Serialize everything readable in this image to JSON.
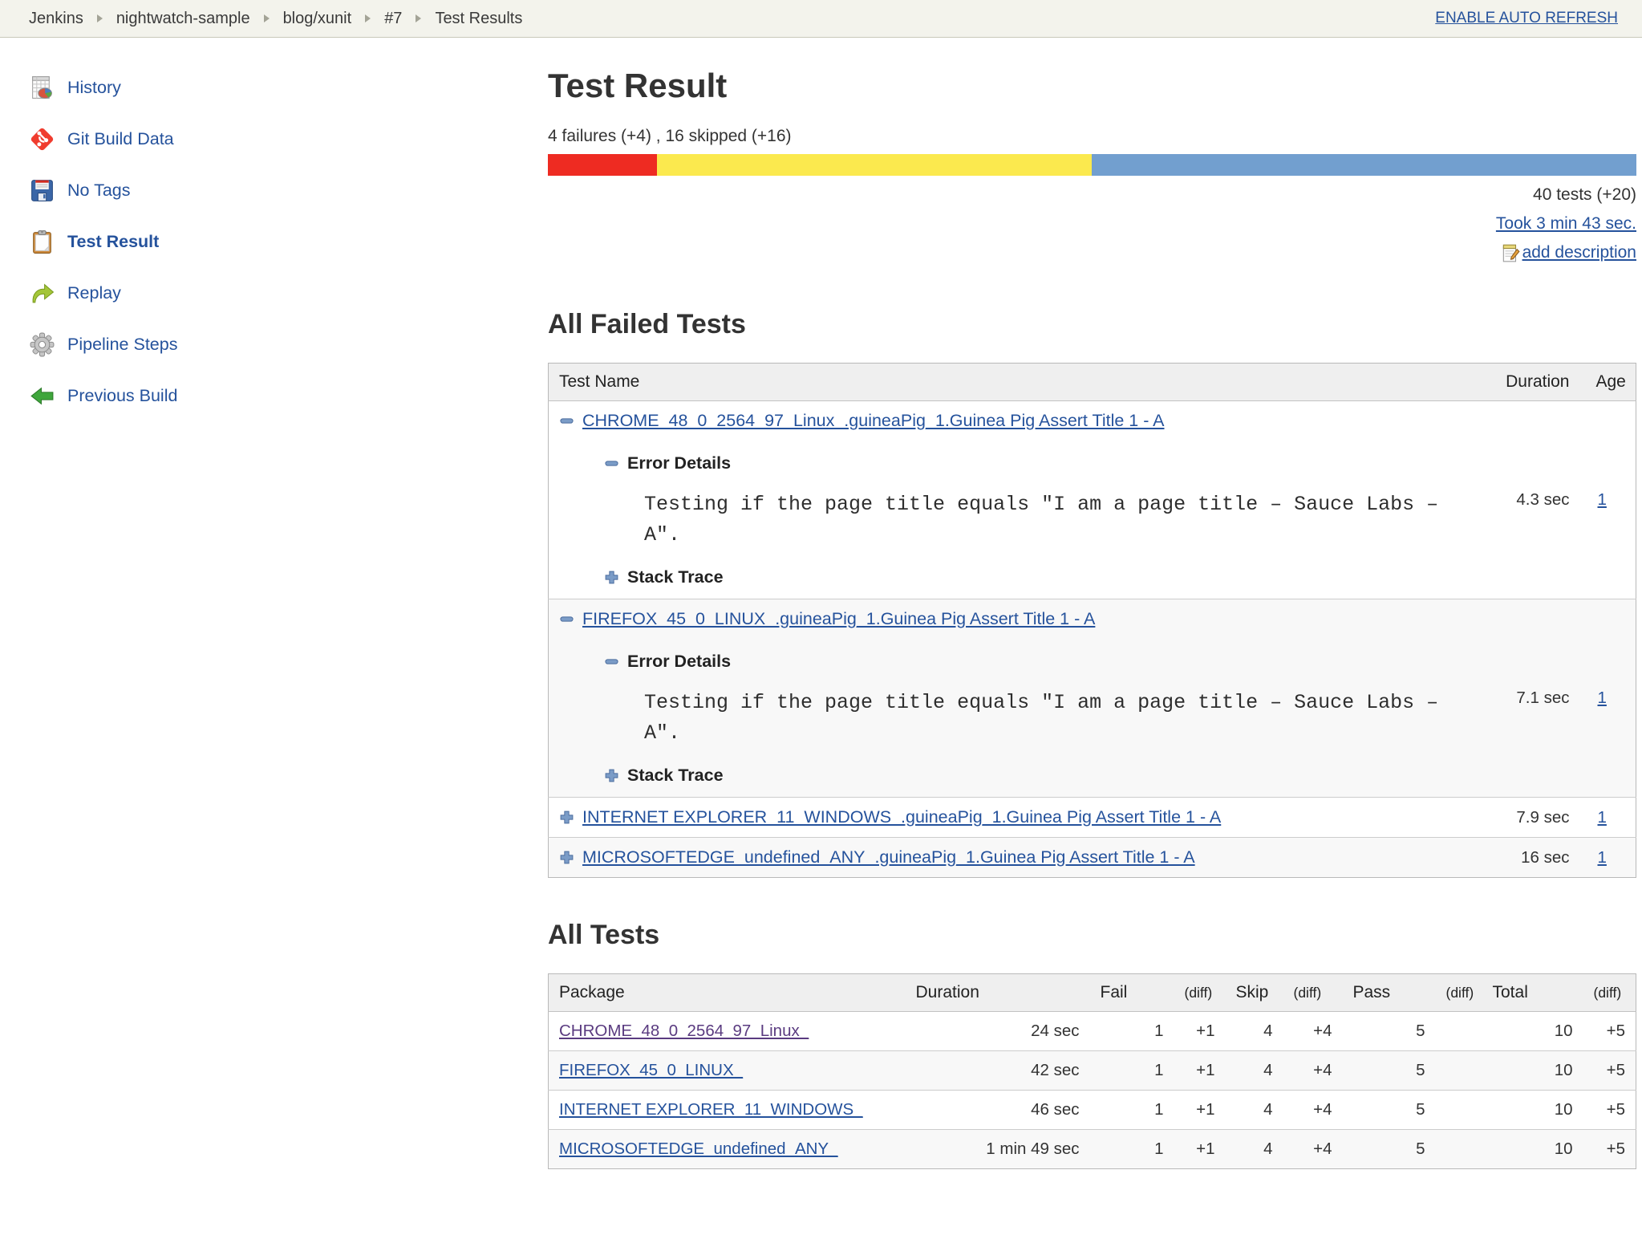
{
  "colors": {
    "link": "#25529c",
    "visited": "#5a3b80",
    "topbar_bg": "#f3f3ec",
    "bar_fail": "#ee2b22",
    "bar_skip": "#fbe94e",
    "bar_pass": "#729fcf"
  },
  "topbar": {
    "breadcrumb": [
      "Jenkins",
      "nightwatch-sample",
      "blog/xunit",
      "#7",
      "Test Results"
    ],
    "auto_refresh_label": "ENABLE AUTO REFRESH"
  },
  "sidebar": {
    "items": [
      {
        "label": "History",
        "icon": "history-icon",
        "active": false
      },
      {
        "label": "Git Build Data",
        "icon": "git-icon",
        "active": false
      },
      {
        "label": "No Tags",
        "icon": "floppy-disk-icon",
        "active": false
      },
      {
        "label": "Test Result",
        "icon": "clipboard-icon",
        "active": true
      },
      {
        "label": "Replay",
        "icon": "replay-arrow-icon",
        "active": false
      },
      {
        "label": "Pipeline Steps",
        "icon": "gear-icon",
        "active": false
      },
      {
        "label": "Previous Build",
        "icon": "previous-build-arrow-icon",
        "active": false
      }
    ]
  },
  "main": {
    "title": "Test Result",
    "summary": "4 failures (+4) , 16 skipped (+16)",
    "bar": {
      "fail_pct": 10,
      "skip_pct": 40,
      "pass_pct": 50
    },
    "tests_count": "40 tests (+20)",
    "took_label": "Took 3 min 43 sec.",
    "add_description_label": "add description",
    "failed": {
      "heading": "All Failed Tests",
      "col_test_name": "Test Name",
      "col_duration": "Duration",
      "col_age": "Age",
      "error_details_label": "Error Details",
      "stack_trace_label": "Stack Trace",
      "rows": [
        {
          "name": "CHROME_48_0_2564_97_Linux_.guineaPig_1.Guinea Pig Assert Title 1 - A",
          "expanded": true,
          "error_text": "Testing if the page title equals \"I am a page title – Sauce Labs – A\".",
          "duration": "4.3 sec",
          "age": "1"
        },
        {
          "name": "FIREFOX_45_0_LINUX_.guineaPig_1.Guinea Pig Assert Title 1 - A",
          "expanded": true,
          "error_text": "Testing if the page title equals \"I am a page title – Sauce Labs – A\".",
          "duration": "7.1 sec",
          "age": "1"
        },
        {
          "name": "INTERNET EXPLORER_11_WINDOWS_.guineaPig_1.Guinea Pig Assert Title 1 - A",
          "expanded": false,
          "duration": "7.9 sec",
          "age": "1"
        },
        {
          "name": "MICROSOFTEDGE_undefined_ANY_.guineaPig_1.Guinea Pig Assert Title 1 - A",
          "expanded": false,
          "duration": "16 sec",
          "age": "1"
        }
      ]
    },
    "all_tests": {
      "heading": "All Tests",
      "columns": [
        "Package",
        "Duration",
        "Fail",
        "(diff)",
        "Skip",
        "(diff)",
        "Pass",
        "(diff)",
        "Total",
        "(diff)"
      ],
      "rows": [
        {
          "package": "CHROME_48_0_2564_97_Linux_",
          "visited": true,
          "duration": "24 sec",
          "fail": "1",
          "fail_diff": "+1",
          "skip": "4",
          "skip_diff": "+4",
          "pass": "5",
          "pass_diff": "",
          "total": "10",
          "total_diff": "+5"
        },
        {
          "package": "FIREFOX_45_0_LINUX_",
          "visited": false,
          "duration": "42 sec",
          "fail": "1",
          "fail_diff": "+1",
          "skip": "4",
          "skip_diff": "+4",
          "pass": "5",
          "pass_diff": "",
          "total": "10",
          "total_diff": "+5"
        },
        {
          "package": "INTERNET EXPLORER_11_WINDOWS_",
          "visited": false,
          "duration": "46 sec",
          "fail": "1",
          "fail_diff": "+1",
          "skip": "4",
          "skip_diff": "+4",
          "pass": "5",
          "pass_diff": "",
          "total": "10",
          "total_diff": "+5"
        },
        {
          "package": "MICROSOFTEDGE_undefined_ANY_",
          "visited": false,
          "duration": "1 min 49 sec",
          "fail": "1",
          "fail_diff": "+1",
          "skip": "4",
          "skip_diff": "+4",
          "pass": "5",
          "pass_diff": "",
          "total": "10",
          "total_diff": "+5"
        }
      ]
    }
  }
}
